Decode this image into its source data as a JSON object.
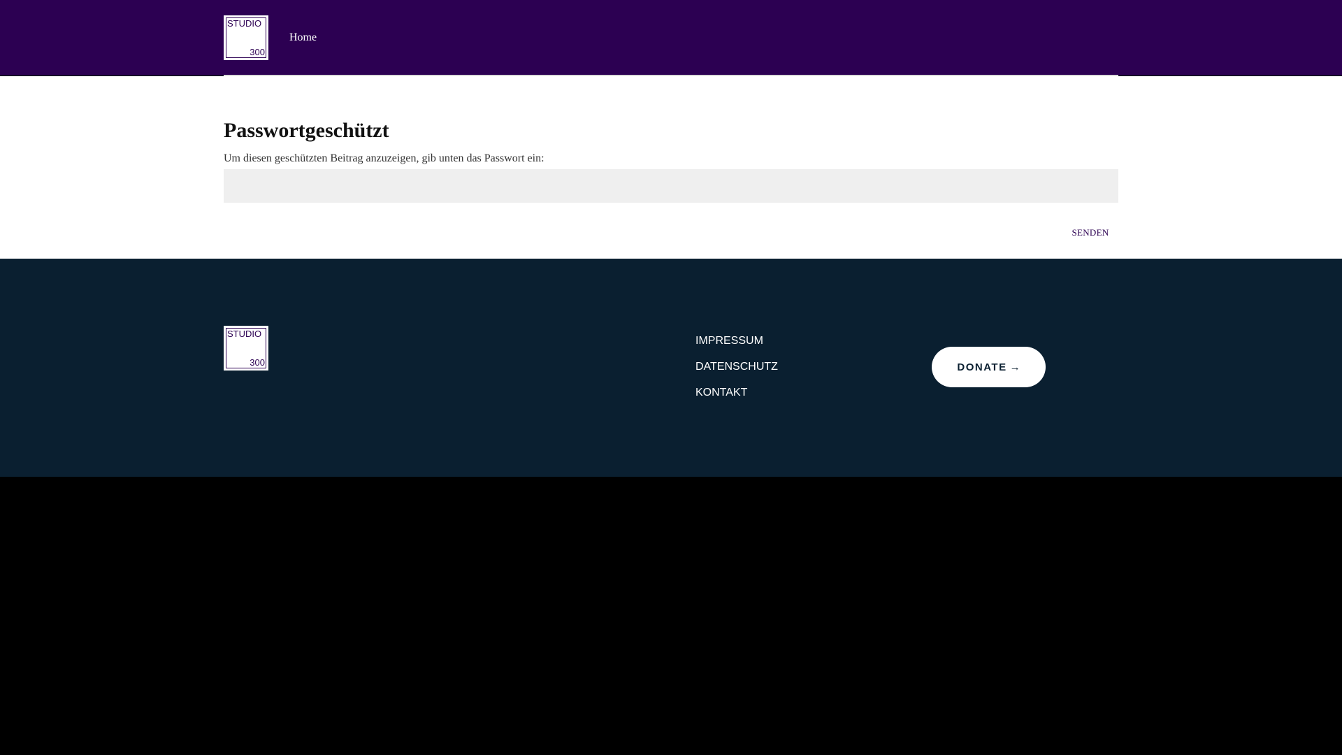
{
  "header": {
    "logo": {
      "line1": "STUDIO",
      "line2": "300"
    },
    "nav": {
      "home_label": "Home"
    }
  },
  "main": {
    "title": "Passwortgeschützt",
    "prompt": "Um diesen geschützten Beitrag anzuzeigen, gib unten das Passwort ein:",
    "password_value": "",
    "submit_label": "SENDEN"
  },
  "footer": {
    "logo": {
      "line1": "STUDIO",
      "line2": "300"
    },
    "links": [
      "IMPRESSUM",
      "DATENSCHUTZ",
      "KONTAKT"
    ],
    "donate_label": "DONATE",
    "donate_arrow": "→"
  },
  "colors": {
    "header_bg": "#2c0052",
    "footer_bg": "#0a1f30",
    "accent": "#2c0052"
  },
  "icons": {
    "donate": "arrow-right-icon"
  }
}
